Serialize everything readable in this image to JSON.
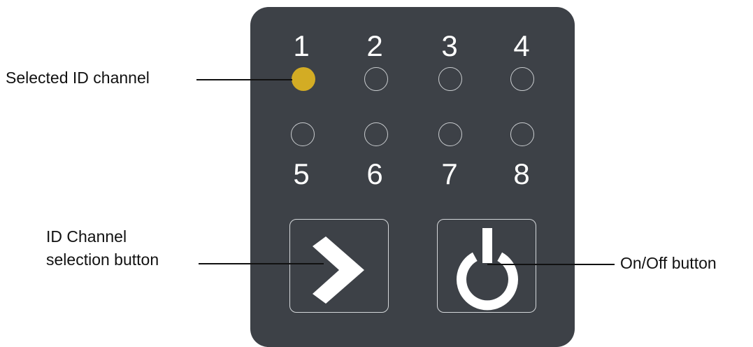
{
  "panel": {
    "background_color": "#3d4147",
    "text_color": "#ffffff",
    "channels_top": [
      "1",
      "2",
      "3",
      "4"
    ],
    "channels_bottom": [
      "5",
      "6",
      "7",
      "8"
    ],
    "selected_channel": "1",
    "selected_led_color": "#d3ac24",
    "off_led_outline_color": "#c9cccf",
    "next_button_icon": "chevron-right-icon",
    "power_button_icon": "power-icon"
  },
  "callouts": {
    "selected_channel": "Selected ID channel",
    "selection_button_line1": "ID Channel",
    "selection_button_line2": "selection button",
    "power_button": "On/Off button"
  }
}
